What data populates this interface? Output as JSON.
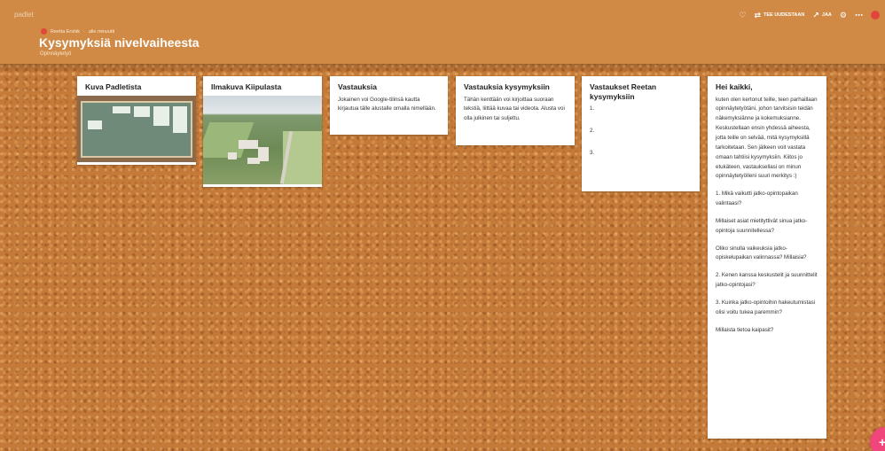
{
  "header": {
    "brand": "padlet",
    "author": "Reetta Ershik",
    "time": "alle minuutti",
    "title": "Kysymyksiä nivelvaiheesta",
    "subtitle": "Opinnäytetyö",
    "toolbar": {
      "remake_label": "TEE UUDESTAAN",
      "share_label": "JAA"
    }
  },
  "cards": [
    {
      "title": "Kuva Padletista"
    },
    {
      "title": "Ilmakuva Kiipulasta"
    },
    {
      "title": "Vastauksia",
      "body": "Jokainen voi Google-tilinsä kautta kirjautua tälle alustalle omalla nimellään."
    },
    {
      "title": "Vastauksia kysymyksiin",
      "body": "Tähän kenttään voi kirjoittaa suoraan tekstiä, liittää kuvaa tai videota. Alusta voi olla julkinen tai suljettu."
    },
    {
      "title": "Vastaukset Reetan kysymyksiin",
      "items": [
        "1.",
        "2.",
        "3."
      ]
    },
    {
      "title": "Hei kaikki,",
      "paragraphs": [
        "kuten olen kertonut teille, teen parhaillaan opinnäytetyötäni, johon tarvitsisin teidän näkemyksiänne ja kokemuksianne. Keskustellaan ensin yhdessä aiheesta, jotta teille on selvää, mitä kysymyksillä tarkoitetaan. Sen jälkeen voit vastata omaan tahtiisi kysymyksiin. Kiitos jo etukäteen, vastauksellasi on minun opinnäytetyölleni suuri merkitys :)",
        "1. Mikä vaikutti jatko-opintopaikan valintaasi?",
        "Millaiset asiat mietityttivät sinua jatko-opintoja suunnitellessa?",
        "Oliko sinulla vaikeuksia jatko-opiskelupaikan valinnassa? Millaisia?",
        "2. Kenen kanssa keskustelit ja suunnittelit jatko-opintojasi?",
        "3. Kuinka jatko-opintoihin hakeutumistasi olisi voitu tukea paremmin?",
        "Millaista tietoa kaipasit?"
      ]
    }
  ],
  "fab": {
    "label": "+"
  },
  "colors": {
    "header": "#d08a45",
    "board": "#c47a38",
    "accent_red": "#e2453a",
    "fab": "#f0467b"
  },
  "icons": [
    "heart-icon",
    "remake-icon",
    "share-icon",
    "gear-icon",
    "more-icon"
  ]
}
